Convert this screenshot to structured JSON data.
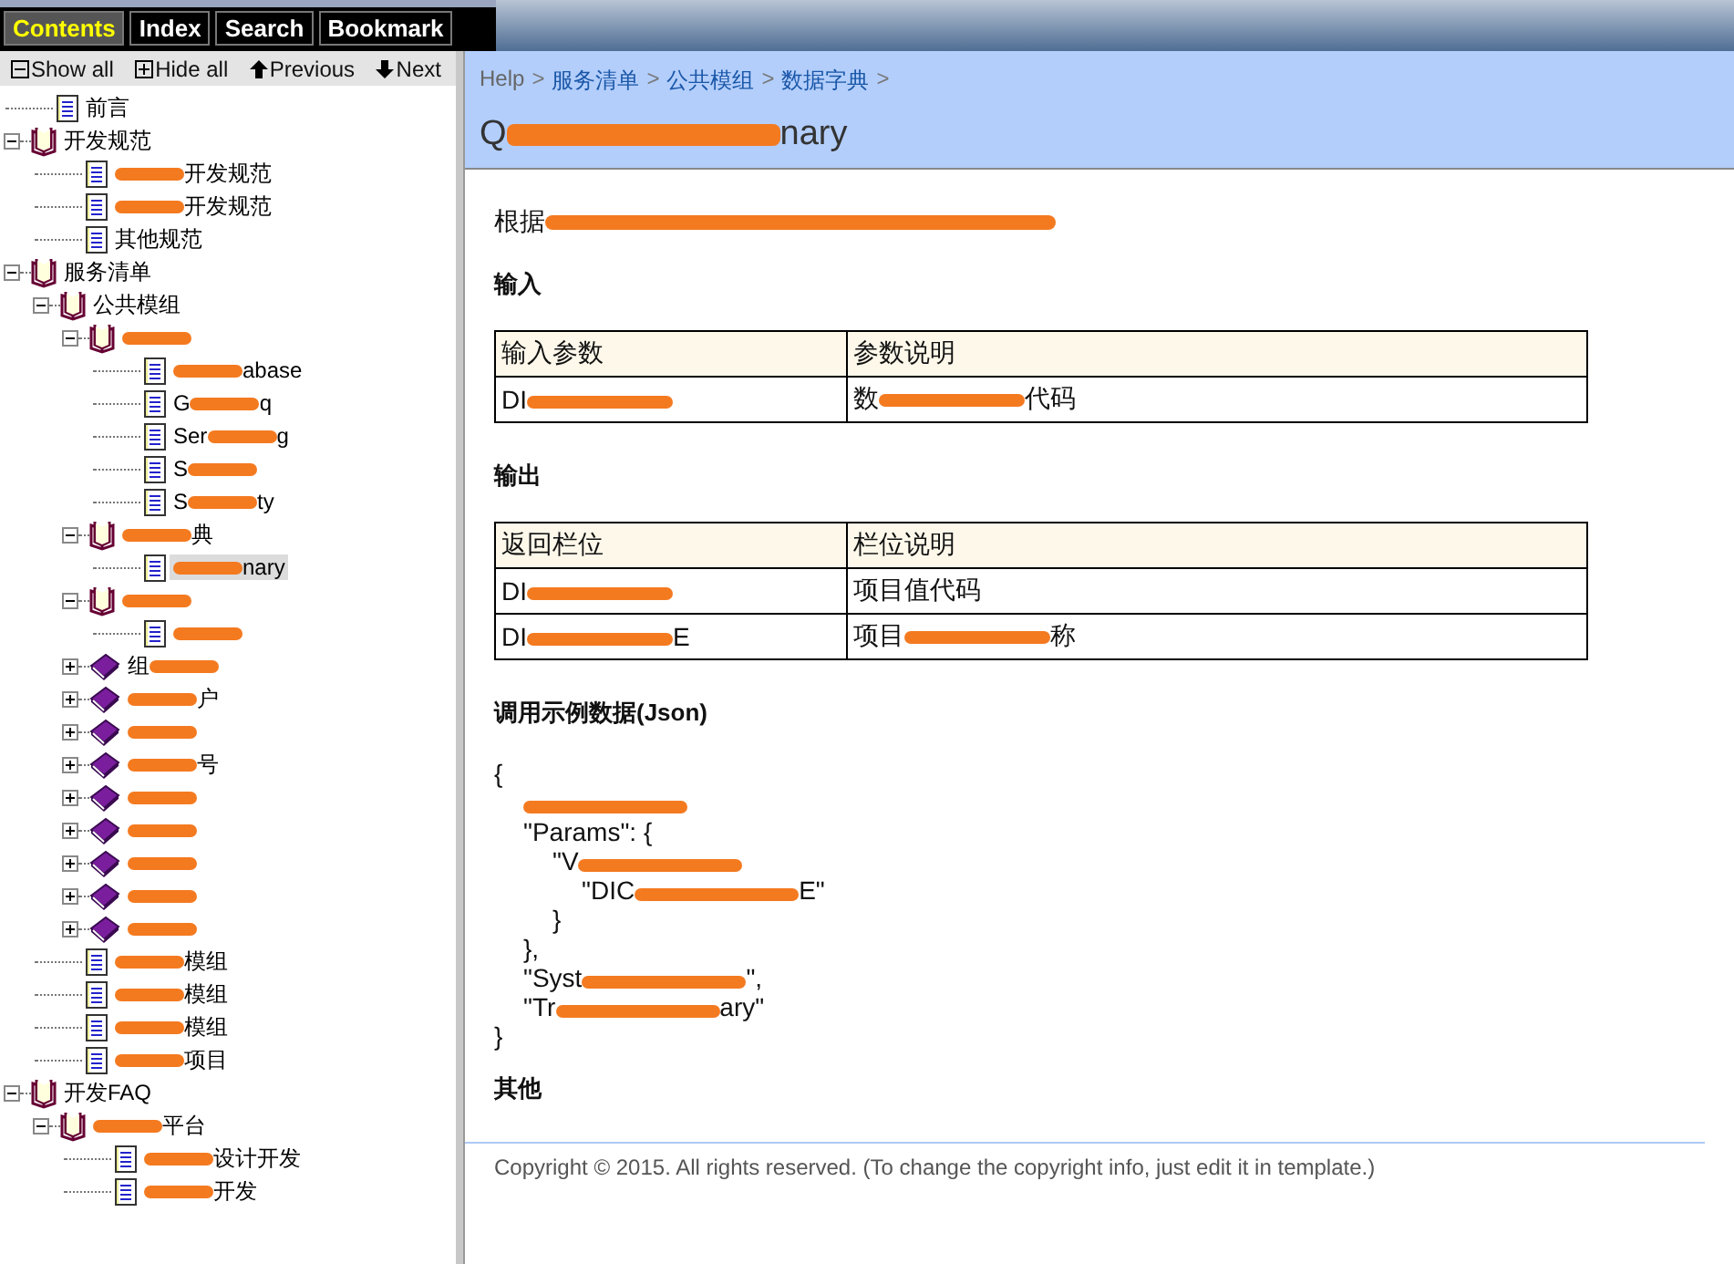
{
  "tabs": [
    {
      "label": "Contents",
      "selected": true
    },
    {
      "label": "Index",
      "selected": false
    },
    {
      "label": "Search",
      "selected": false
    },
    {
      "label": "Bookmark",
      "selected": false
    }
  ],
  "toolbar": [
    {
      "kind": "collapse",
      "label": "Show all"
    },
    {
      "kind": "expand",
      "label": "Hide all"
    },
    {
      "kind": "up",
      "label": "Previous"
    },
    {
      "kind": "down",
      "label": "Next"
    }
  ],
  "tree": [
    {
      "kind": "page",
      "selected": false,
      "parts": [
        {
          "text": "前言"
        }
      ]
    },
    {
      "kind": "book",
      "expanded": true,
      "selected": false,
      "parts": [
        {
          "text": "开发规范"
        }
      ],
      "children": [
        {
          "kind": "page",
          "selected": false,
          "parts": [
            {
              "kind": "redaction"
            },
            {
              "text": "开发规范"
            }
          ]
        },
        {
          "kind": "page",
          "selected": false,
          "parts": [
            {
              "kind": "redaction"
            },
            {
              "text": "开发规范"
            }
          ]
        },
        {
          "kind": "page",
          "selected": false,
          "parts": [
            {
              "text": "其他规范"
            }
          ]
        }
      ]
    },
    {
      "kind": "book",
      "expanded": true,
      "selected": false,
      "parts": [
        {
          "text": "服务清单"
        }
      ],
      "children": [
        {
          "kind": "book",
          "expanded": true,
          "selected": false,
          "parts": [
            {
              "text": "公共模组"
            }
          ],
          "children": [
            {
              "kind": "book",
              "expanded": true,
              "selected": false,
              "parts": [
                {
                  "kind": "redaction"
                }
              ],
              "children": [
                {
                  "kind": "page",
                  "selected": false,
                  "parts": [
                    {
                      "kind": "redaction"
                    },
                    {
                      "text": "abase"
                    }
                  ]
                },
                {
                  "kind": "page",
                  "selected": false,
                  "parts": [
                    {
                      "text": "G"
                    },
                    {
                      "kind": "redaction"
                    },
                    {
                      "text": "q"
                    }
                  ]
                },
                {
                  "kind": "page",
                  "selected": false,
                  "parts": [
                    {
                      "text": "Ser"
                    },
                    {
                      "kind": "redaction"
                    },
                    {
                      "text": "g"
                    }
                  ]
                },
                {
                  "kind": "page",
                  "selected": false,
                  "parts": [
                    {
                      "text": "S"
                    },
                    {
                      "kind": "redaction"
                    }
                  ]
                },
                {
                  "kind": "page",
                  "selected": false,
                  "parts": [
                    {
                      "text": "S"
                    },
                    {
                      "kind": "redaction"
                    },
                    {
                      "text": "ty"
                    }
                  ]
                }
              ]
            },
            {
              "kind": "book",
              "expanded": true,
              "selected": false,
              "parts": [
                {
                  "kind": "redaction"
                },
                {
                  "text": "典"
                }
              ],
              "children": [
                {
                  "kind": "page",
                  "selected": true,
                  "parts": [
                    {
                      "kind": "redaction"
                    },
                    {
                      "text": "nary"
                    }
                  ]
                }
              ]
            },
            {
              "kind": "book",
              "expanded": true,
              "selected": false,
              "parts": [
                {
                  "kind": "redaction"
                }
              ],
              "children": [
                {
                  "kind": "page",
                  "selected": false,
                  "parts": [
                    {
                      "kind": "redaction"
                    }
                  ]
                }
              ]
            },
            {
              "kind": "book",
              "expanded": false,
              "selected": false,
              "parts": [
                {
                  "text": "组"
                },
                {
                  "kind": "redaction"
                }
              ]
            },
            {
              "kind": "book",
              "expanded": false,
              "selected": false,
              "parts": [
                {
                  "kind": "redaction"
                },
                {
                  "text": "户"
                }
              ]
            },
            {
              "kind": "book",
              "expanded": false,
              "selected": false,
              "parts": [
                {
                  "kind": "redaction"
                }
              ]
            },
            {
              "kind": "book",
              "expanded": false,
              "selected": false,
              "parts": [
                {
                  "kind": "redaction"
                },
                {
                  "text": "号"
                }
              ]
            },
            {
              "kind": "book",
              "expanded": false,
              "selected": false,
              "parts": [
                {
                  "kind": "redaction"
                }
              ]
            },
            {
              "kind": "book",
              "expanded": false,
              "selected": false,
              "parts": [
                {
                  "kind": "redaction"
                }
              ]
            },
            {
              "kind": "book",
              "expanded": false,
              "selected": false,
              "parts": [
                {
                  "kind": "redaction"
                }
              ]
            },
            {
              "kind": "book",
              "expanded": false,
              "selected": false,
              "parts": [
                {
                  "kind": "redaction"
                }
              ]
            },
            {
              "kind": "book",
              "expanded": false,
              "selected": false,
              "parts": [
                {
                  "kind": "redaction"
                }
              ]
            }
          ]
        },
        {
          "kind": "page",
          "selected": false,
          "parts": [
            {
              "kind": "redaction"
            },
            {
              "text": "模组"
            }
          ]
        },
        {
          "kind": "page",
          "selected": false,
          "parts": [
            {
              "kind": "redaction"
            },
            {
              "text": "模组"
            }
          ]
        },
        {
          "kind": "page",
          "selected": false,
          "parts": [
            {
              "kind": "redaction"
            },
            {
              "text": "模组"
            }
          ]
        },
        {
          "kind": "page",
          "selected": false,
          "parts": [
            {
              "kind": "redaction"
            },
            {
              "text": "项目"
            }
          ]
        }
      ]
    },
    {
      "kind": "book",
      "expanded": true,
      "selected": false,
      "parts": [
        {
          "text": "开发FAQ"
        }
      ],
      "children": [
        {
          "kind": "book",
          "expanded": true,
          "selected": false,
          "parts": [
            {
              "kind": "redaction"
            },
            {
              "text": "平台"
            }
          ],
          "children": [
            {
              "kind": "page",
              "selected": false,
              "parts": [
                {
                  "kind": "redaction"
                },
                {
                  "text": "设计开发"
                }
              ]
            },
            {
              "kind": "page",
              "selected": false,
              "parts": [
                {
                  "kind": "redaction"
                },
                {
                  "text": "开发"
                }
              ]
            }
          ]
        }
      ]
    }
  ],
  "breadcrumb": [
    "Help",
    "服务清单",
    "公共模组",
    "数据字典"
  ],
  "breadcrumb_separator": ">",
  "title": [
    {
      "text": "Q"
    },
    {
      "kind": "redaction"
    },
    {
      "text": "nary"
    }
  ],
  "description": [
    {
      "text": "根据"
    },
    {
      "kind": "redaction"
    }
  ],
  "sections": [
    {
      "kind": "table",
      "heading": "输入",
      "columns": [
        "输入参数",
        "参数说明"
      ],
      "rows": [
        [
          [
            {
              "text": "DI"
            },
            {
              "kind": "redaction"
            }
          ],
          [
            {
              "text": "数"
            },
            {
              "kind": "redaction"
            },
            {
              "text": "代码"
            }
          ]
        ]
      ]
    },
    {
      "kind": "table",
      "heading": "输出",
      "columns": [
        "返回栏位",
        "栏位说明"
      ],
      "rows": [
        [
          [
            {
              "text": "DI"
            },
            {
              "kind": "redaction"
            }
          ],
          [
            {
              "text": "项目值代码"
            }
          ]
        ],
        [
          [
            {
              "text": "DI"
            },
            {
              "kind": "redaction"
            },
            {
              "text": "E"
            }
          ],
          [
            {
              "text": "项目"
            },
            {
              "kind": "redaction"
            },
            {
              "text": "称"
            }
          ]
        ]
      ]
    },
    {
      "kind": "code",
      "heading": "调用示例数据(Json)",
      "lines": [
        {
          "parts": [
            {
              "text": "{"
            }
          ],
          "children": [
            {
              "parts": [
                {
                  "kind": "redaction"
                }
              ]
            },
            {
              "parts": [
                {
                  "text": "\"Params\": {"
                }
              ],
              "children": [
                {
                  "parts": [
                    {
                      "text": "\"V"
                    },
                    {
                      "kind": "redaction"
                    }
                  ],
                  "children": [
                    {
                      "parts": [
                        {
                          "text": "\"DIC"
                        },
                        {
                          "kind": "redaction"
                        },
                        {
                          "text": "E\""
                        }
                      ]
                    }
                  ]
                },
                {
                  "parts": [
                    {
                      "text": "}"
                    }
                  ]
                }
              ]
            },
            {
              "parts": [
                {
                  "text": "},"
                }
              ]
            },
            {
              "parts": [
                {
                  "text": "\"Syst"
                },
                {
                  "kind": "redaction"
                },
                {
                  "text": "\","
                }
              ]
            },
            {
              "parts": [
                {
                  "text": "\"Tr"
                },
                {
                  "kind": "redaction"
                },
                {
                  "text": "ary\""
                }
              ]
            }
          ]
        },
        {
          "parts": [
            {
              "text": "}"
            }
          ]
        }
      ]
    },
    {
      "kind": "heading",
      "heading": "其他"
    }
  ],
  "footer": "Copyright © 2015. All rights reserved. (To change the copyright info, just edit it in template.)"
}
